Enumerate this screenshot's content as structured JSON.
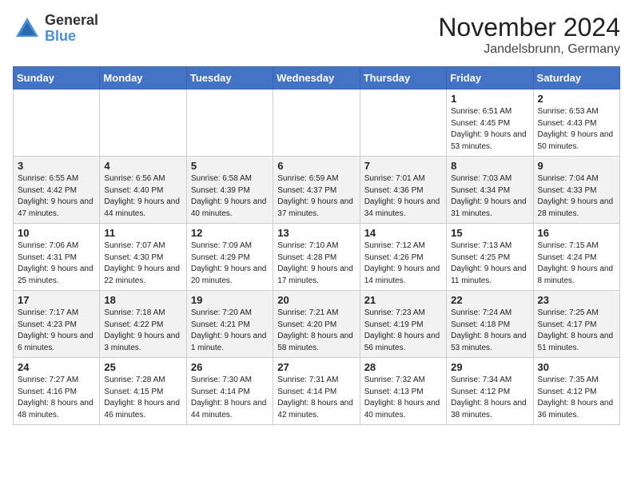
{
  "logo": {
    "general": "General",
    "blue": "Blue"
  },
  "title": "November 2024",
  "location": "Jandelsbrunn, Germany",
  "days_of_week": [
    "Sunday",
    "Monday",
    "Tuesday",
    "Wednesday",
    "Thursday",
    "Friday",
    "Saturday"
  ],
  "weeks": [
    [
      {
        "day": "",
        "info": ""
      },
      {
        "day": "",
        "info": ""
      },
      {
        "day": "",
        "info": ""
      },
      {
        "day": "",
        "info": ""
      },
      {
        "day": "",
        "info": ""
      },
      {
        "day": "1",
        "info": "Sunrise: 6:51 AM\nSunset: 4:45 PM\nDaylight: 9 hours and 53 minutes."
      },
      {
        "day": "2",
        "info": "Sunrise: 6:53 AM\nSunset: 4:43 PM\nDaylight: 9 hours and 50 minutes."
      }
    ],
    [
      {
        "day": "3",
        "info": "Sunrise: 6:55 AM\nSunset: 4:42 PM\nDaylight: 9 hours and 47 minutes."
      },
      {
        "day": "4",
        "info": "Sunrise: 6:56 AM\nSunset: 4:40 PM\nDaylight: 9 hours and 44 minutes."
      },
      {
        "day": "5",
        "info": "Sunrise: 6:58 AM\nSunset: 4:39 PM\nDaylight: 9 hours and 40 minutes."
      },
      {
        "day": "6",
        "info": "Sunrise: 6:59 AM\nSunset: 4:37 PM\nDaylight: 9 hours and 37 minutes."
      },
      {
        "day": "7",
        "info": "Sunrise: 7:01 AM\nSunset: 4:36 PM\nDaylight: 9 hours and 34 minutes."
      },
      {
        "day": "8",
        "info": "Sunrise: 7:03 AM\nSunset: 4:34 PM\nDaylight: 9 hours and 31 minutes."
      },
      {
        "day": "9",
        "info": "Sunrise: 7:04 AM\nSunset: 4:33 PM\nDaylight: 9 hours and 28 minutes."
      }
    ],
    [
      {
        "day": "10",
        "info": "Sunrise: 7:06 AM\nSunset: 4:31 PM\nDaylight: 9 hours and 25 minutes."
      },
      {
        "day": "11",
        "info": "Sunrise: 7:07 AM\nSunset: 4:30 PM\nDaylight: 9 hours and 22 minutes."
      },
      {
        "day": "12",
        "info": "Sunrise: 7:09 AM\nSunset: 4:29 PM\nDaylight: 9 hours and 20 minutes."
      },
      {
        "day": "13",
        "info": "Sunrise: 7:10 AM\nSunset: 4:28 PM\nDaylight: 9 hours and 17 minutes."
      },
      {
        "day": "14",
        "info": "Sunrise: 7:12 AM\nSunset: 4:26 PM\nDaylight: 9 hours and 14 minutes."
      },
      {
        "day": "15",
        "info": "Sunrise: 7:13 AM\nSunset: 4:25 PM\nDaylight: 9 hours and 11 minutes."
      },
      {
        "day": "16",
        "info": "Sunrise: 7:15 AM\nSunset: 4:24 PM\nDaylight: 9 hours and 8 minutes."
      }
    ],
    [
      {
        "day": "17",
        "info": "Sunrise: 7:17 AM\nSunset: 4:23 PM\nDaylight: 9 hours and 6 minutes."
      },
      {
        "day": "18",
        "info": "Sunrise: 7:18 AM\nSunset: 4:22 PM\nDaylight: 9 hours and 3 minutes."
      },
      {
        "day": "19",
        "info": "Sunrise: 7:20 AM\nSunset: 4:21 PM\nDaylight: 9 hours and 1 minute."
      },
      {
        "day": "20",
        "info": "Sunrise: 7:21 AM\nSunset: 4:20 PM\nDaylight: 8 hours and 58 minutes."
      },
      {
        "day": "21",
        "info": "Sunrise: 7:23 AM\nSunset: 4:19 PM\nDaylight: 8 hours and 56 minutes."
      },
      {
        "day": "22",
        "info": "Sunrise: 7:24 AM\nSunset: 4:18 PM\nDaylight: 8 hours and 53 minutes."
      },
      {
        "day": "23",
        "info": "Sunrise: 7:25 AM\nSunset: 4:17 PM\nDaylight: 8 hours and 51 minutes."
      }
    ],
    [
      {
        "day": "24",
        "info": "Sunrise: 7:27 AM\nSunset: 4:16 PM\nDaylight: 8 hours and 48 minutes."
      },
      {
        "day": "25",
        "info": "Sunrise: 7:28 AM\nSunset: 4:15 PM\nDaylight: 8 hours and 46 minutes."
      },
      {
        "day": "26",
        "info": "Sunrise: 7:30 AM\nSunset: 4:14 PM\nDaylight: 8 hours and 44 minutes."
      },
      {
        "day": "27",
        "info": "Sunrise: 7:31 AM\nSunset: 4:14 PM\nDaylight: 8 hours and 42 minutes."
      },
      {
        "day": "28",
        "info": "Sunrise: 7:32 AM\nSunset: 4:13 PM\nDaylight: 8 hours and 40 minutes."
      },
      {
        "day": "29",
        "info": "Sunrise: 7:34 AM\nSunset: 4:12 PM\nDaylight: 8 hours and 38 minutes."
      },
      {
        "day": "30",
        "info": "Sunrise: 7:35 AM\nSunset: 4:12 PM\nDaylight: 8 hours and 36 minutes."
      }
    ]
  ]
}
